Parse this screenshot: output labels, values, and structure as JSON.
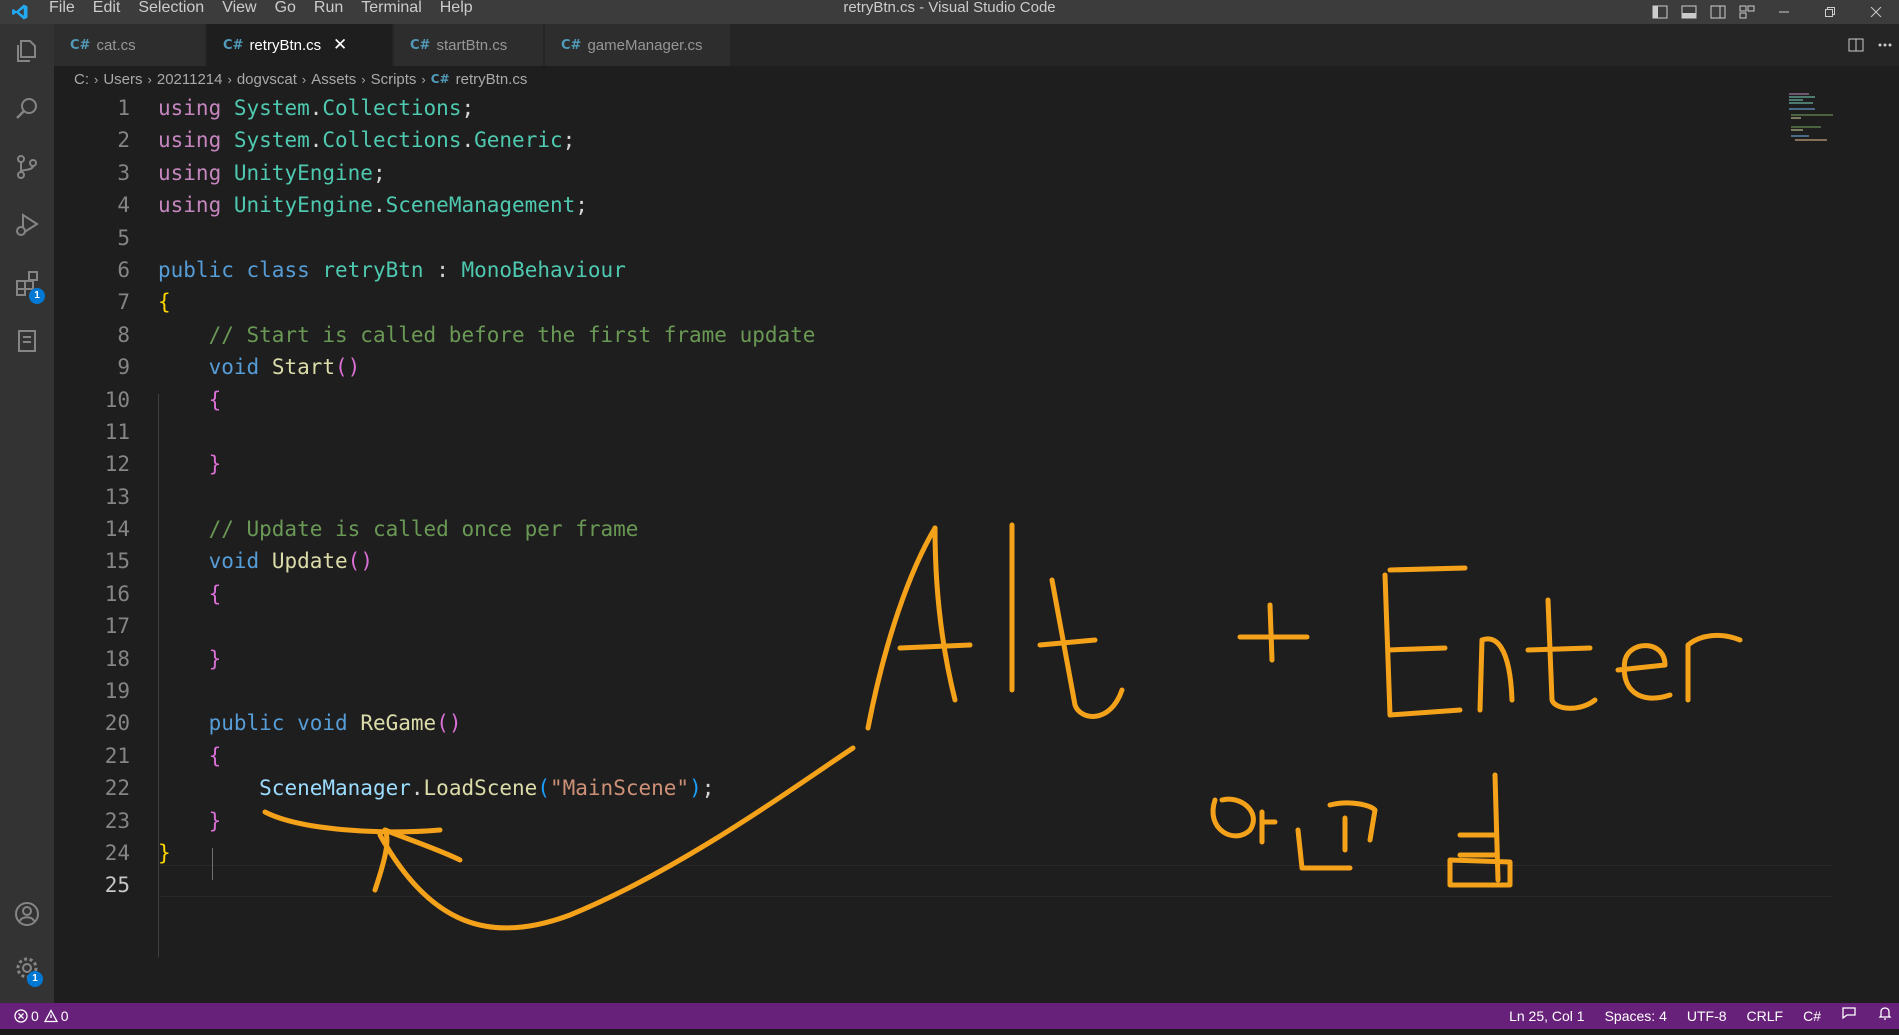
{
  "window": {
    "title": "retryBtn.cs - Visual Studio Code",
    "menu": [
      "File",
      "Edit",
      "Selection",
      "View",
      "Go",
      "Run",
      "Terminal",
      "Help"
    ]
  },
  "activity_bar": {
    "items": [
      "explorer-icon",
      "search-icon",
      "source-control-icon",
      "run-debug-icon",
      "extensions-icon",
      "notebook-icon"
    ],
    "extensions_badge": "1",
    "accounts_icon": "account-icon",
    "settings_badge": "1"
  },
  "tabs": [
    {
      "label": "cat.cs",
      "icon": "C#",
      "active": false
    },
    {
      "label": "retryBtn.cs",
      "icon": "C#",
      "active": true
    },
    {
      "label": "startBtn.cs",
      "icon": "C#",
      "active": false
    },
    {
      "label": "gameManager.cs",
      "icon": "C#",
      "active": false
    }
  ],
  "breadcrumb": {
    "items": [
      "C:",
      "Users",
      "20211214",
      "dogvscat",
      "Assets",
      "Scripts"
    ],
    "file_icon": "C#",
    "file": "retryBtn.cs"
  },
  "editor": {
    "line_numbers": [
      "1",
      "2",
      "3",
      "4",
      "5",
      "6",
      "7",
      "8",
      "9",
      "10",
      "11",
      "12",
      "13",
      "14",
      "15",
      "16",
      "17",
      "18",
      "19",
      "20",
      "21",
      "22",
      "23",
      "24",
      "25"
    ],
    "current_line": 25,
    "tokens": {
      "using": "using",
      "sys_ns": "System",
      "dot": ".",
      "collections": "Collections",
      "generic": "Generic",
      "semi": ";",
      "unityengine": "UnityEngine",
      "scenemanagement": "SceneManagement",
      "public": "public",
      "class": "class",
      "classname": "retryBtn",
      "colon": " : ",
      "monobehaviour": "MonoBehaviour",
      "lbrace": "{",
      "rbrace": "}",
      "comment1": "// Start is called before the first frame update",
      "void": "void",
      "start": "Start",
      "parens": "()",
      "comment2": "// Update is called once per frame",
      "update": "Update",
      "regame": "ReGame",
      "scenemanager": "SceneManager",
      "loadscene": "LoadScene",
      "lparen": "(",
      "rparen": ")",
      "string": "\"MainScene\""
    }
  },
  "annotation": {
    "text1": "Alt + Enter",
    "text2": "안됨",
    "color": "#f5a21b"
  },
  "status_bar": {
    "errors": "0",
    "warnings": "0",
    "position": "Ln 25, Col 1",
    "spaces": "Spaces: 4",
    "encoding": "UTF-8",
    "eol": "CRLF",
    "language": "C#"
  },
  "colors": {
    "statusbar": "#68217a",
    "activitybar": "#333333",
    "editor_bg": "#1e1e1e",
    "accent": "#0078d4"
  }
}
